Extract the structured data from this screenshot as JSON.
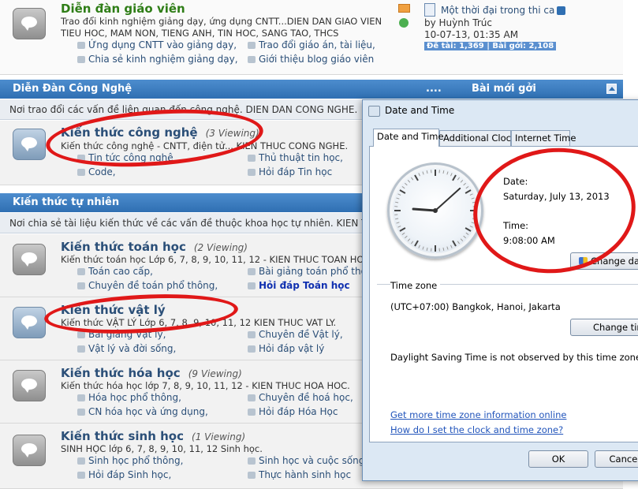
{
  "forum": {
    "top": {
      "title": "Diễn đàn giáo viên",
      "desc1": "Trao đổi kinh nghiệm giảng dạy, ứng dụng CNTT...DIEN DAN GIAO VIEN",
      "desc2": "TIEU HOC, MAM NON, TIENG ANH, TIN HOC, SANG TAO, THCS",
      "subs": [
        "Ứng dụng CNTT vào giảng dạy,",
        "Trao đổi giáo án, tài liệu,",
        "Chia sẻ kinh nghiệm giảng dạy,",
        "Giới thiệu blog giáo viên"
      ],
      "lastpost": {
        "title": "Một thời đại trong thi ca",
        "by": "by Huỳnh Trúc",
        "date": "10-07-13, 01:35 AM",
        "stats": "Đề tài: 1,369 | Bài gởi: 2,108"
      }
    },
    "tech": {
      "header": "Diễn Đàn Công Nghệ",
      "header_dots": "....",
      "header_newposts": "Bài mới gởi",
      "desc": "Nơi trao đổi các vấn đề liên quan đến công nghệ. DIEN DAN CONG NGHE.",
      "item": {
        "title": "Kiến thức công nghệ",
        "viewing": "(3 Viewing)",
        "desc": "Kiến thức công nghệ - CNTT, điện tử... KIEN THUC CONG NGHE.",
        "subs": [
          "Tin tức công nghệ",
          "Thủ thuật tin học,",
          "Code,",
          "Hỏi đáp Tin học"
        ]
      }
    },
    "nature": {
      "header": "Kiến thức tự nhiên",
      "desc": "Nơi chia sẻ tài liệu kiến thức về các vấn đề thuộc khoa học tự nhiên. KIEN THUC",
      "items": [
        {
          "title": "Kiến thức toán học",
          "viewing": "(2 Viewing)",
          "desc": "Kiến thức toán học Lớp 6, 7, 8, 9, 10, 11, 12 - KIEN THUC TOAN HOC",
          "subs": [
            "Toán cao cấp,",
            "Bài giảng toán phổ thông,",
            "Chuyên đề toán phổ thông,",
            "Hỏi đáp Toán học"
          ]
        },
        {
          "title": "Kiến thức vật lý",
          "viewing": "",
          "desc": "Kiến thức VẬT LÝ Lớp 6, 7, 8, 9, 10, 11, 12 KIEN THUC VAT LY.",
          "subs": [
            "Bài giảng Vật lý,",
            "Chuyên đề Vật lý,",
            "Vật lý và đời sống,",
            "Hỏi đáp vật lý"
          ]
        },
        {
          "title": "Kiến thức hóa học",
          "viewing": "(9 Viewing)",
          "desc": "Kiến thức hóa học lớp 7, 8, 9, 10, 11, 12 - KIEN THUC HOA HOC.",
          "subs": [
            "Hóa học phổ thông,",
            "Chuyên đề hoá học,",
            "CN hóa học và ứng dụng,",
            "Hỏi đáp Hóa Học"
          ]
        },
        {
          "title": "Kiến thức sinh học",
          "viewing": "(1 Viewing)",
          "desc": "SINH HỌC lớp 6, 7, 8, 9, 10, 11, 12 Sinh học.",
          "subs": [
            "Sinh học phổ thông,",
            "Sinh học và cuộc sống,",
            "Hỏi đáp Sinh học,",
            "Thực hành sinh học"
          ]
        }
      ]
    }
  },
  "dialog": {
    "title": "Date and Time",
    "tabs": [
      "Date and Time",
      "Additional Clocks",
      "Internet Time"
    ],
    "date_label": "Date:",
    "date_value": "Saturday, July 13, 2013",
    "time_label": "Time:",
    "time_value": "9:08:00 AM",
    "change_dt_button": "Change date and time...",
    "timezone_label": "Time zone",
    "timezone_value": "(UTC+07:00) Bangkok, Hanoi, Jakarta",
    "change_tz_button": "Change time zone...",
    "dst_text": "Daylight Saving Time is not observed by this time zone.",
    "link1": "Get more time zone information online",
    "link2": "How do I set the clock and time zone?",
    "ok_button": "OK",
    "cancel_button": "Cancel",
    "clock_time": {
      "hour": 9,
      "minute": 8
    }
  }
}
